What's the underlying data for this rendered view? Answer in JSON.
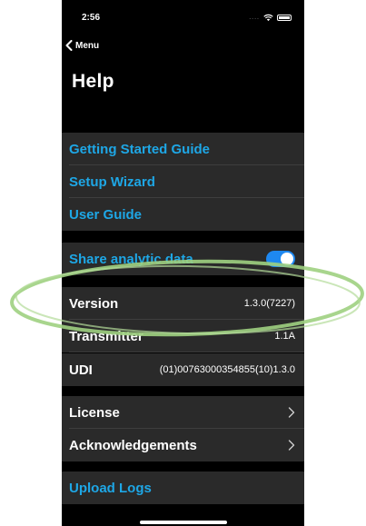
{
  "status_bar": {
    "time": "2:56",
    "signal": "....",
    "icons": [
      "wifi-icon",
      "battery-icon"
    ]
  },
  "nav": {
    "back_label": "Menu",
    "back_icon": "chevron-left-icon"
  },
  "title": "Help",
  "links": [
    {
      "label": "Getting Started Guide"
    },
    {
      "label": "Setup Wizard"
    },
    {
      "label": "User Guide"
    }
  ],
  "analytics": {
    "label": "Share analytic data",
    "enabled": true
  },
  "info": {
    "version_label": "Version",
    "version_value": "1.3.0(7227)",
    "transmitter_label": "Transmitter",
    "transmitter_value": "1.1A",
    "udi_label": "UDI",
    "udi_value": "(01)00763000354855(10)1.3.0"
  },
  "nav_items": [
    {
      "label": "License",
      "icon": "chevron-right-icon"
    },
    {
      "label": "Acknowledgements",
      "icon": "chevron-right-icon"
    }
  ],
  "upload": {
    "label": "Upload Logs"
  },
  "colors": {
    "background": "#000000",
    "cell": "#2a2a2a",
    "link": "#1ea7e6",
    "toggle_on": "#1e88f0",
    "highlight": "#9fd081"
  }
}
